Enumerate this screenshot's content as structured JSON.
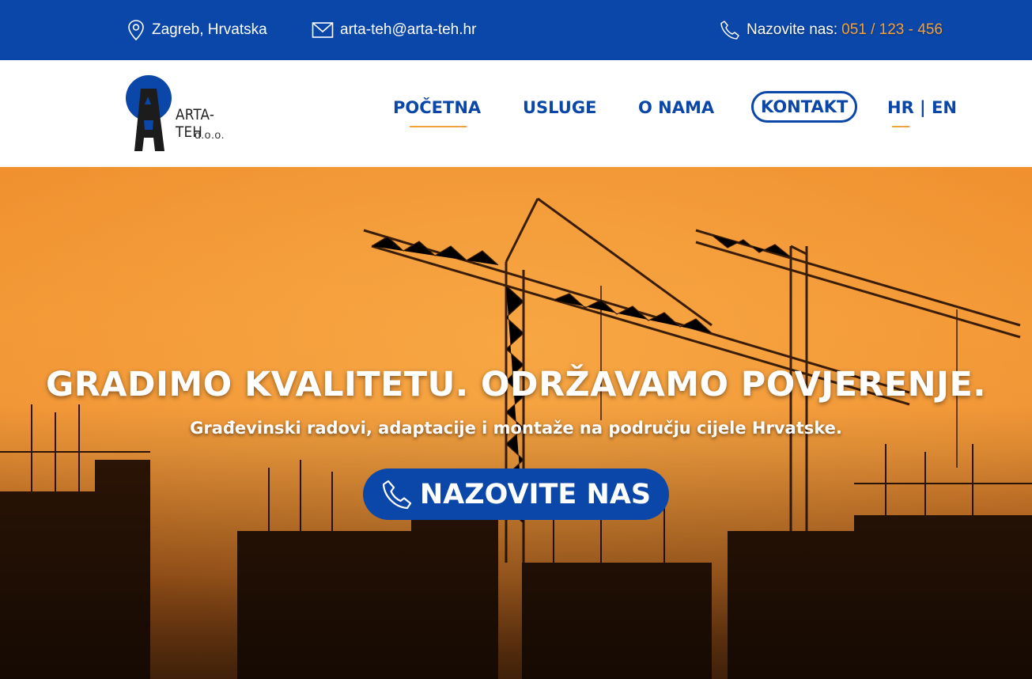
{
  "topbar": {
    "location": "Zagreb, Hrvatska",
    "email": "arta-teh@arta-teh.hr",
    "phone_label": "Nazovite nas:",
    "phone_number": "051 / 123 - 456",
    "icons": [
      "map-pin-icon",
      "mail-icon",
      "phone-icon"
    ]
  },
  "logo": {
    "name": "ARTA-TEH",
    "sub": "d.o.o."
  },
  "nav": {
    "items": [
      "POČETNA",
      "USLUGE",
      "O NAMA",
      "KONTAKT"
    ],
    "active": "POČETNA",
    "highlighted": "KONTAKT",
    "language": "HR | EN"
  },
  "hero": {
    "title": "GRADIMO KVALITETU. ODRŽAVAMO POVJERENJE.",
    "subtitle": "Građevinski radovi, adaptacije i montaže na području cijele Hrvatske.",
    "cta_label": "NAZOVITE NAS",
    "cta_icon": "phone-icon"
  },
  "colors": {
    "brand_blue": "#0a47a8",
    "accent_orange": "#f0a33a"
  }
}
